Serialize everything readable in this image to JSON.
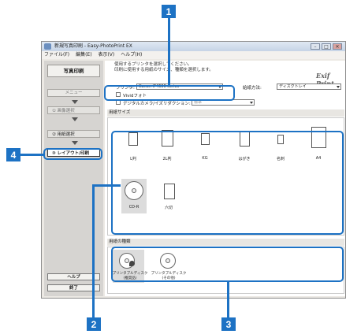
{
  "window": {
    "title": "新規写真印刷 - Easy-PhotoPrint EX",
    "menu": [
      "ファイル(F)",
      "編集(E)",
      "表示(V)",
      "ヘルプ(H)"
    ],
    "buttons": {
      "minimize": "–",
      "maximize": "□",
      "close": "✕"
    }
  },
  "sidebar": {
    "title": "写真印刷",
    "menu_button": "メニュー",
    "steps": [
      "① 画像選択",
      "② 用紙選択",
      "③ レイアウト/印刷"
    ],
    "help_button": "ヘルプ",
    "exit_button": "終了"
  },
  "header": {
    "instruction_line1": "使用するプリンタを選択してください。",
    "instruction_line2": "印刷に使用する用紙のサイズ、種類を選択します。",
    "brand": "Exif Print"
  },
  "settings": {
    "printer_label": "プリンタ:",
    "printer_value": "Canon iP4600 series",
    "feed_label": "給紙方法:",
    "feed_value": "ディスクトレイ",
    "vivid_label": "Vividフォト",
    "camera_label": "デジタルカメラ/イズリダクション:",
    "camera_value": "標準"
  },
  "paper_size": {
    "heading": "用紙サイズ",
    "options": [
      "L判",
      "2L判",
      "KG",
      "はがき",
      "名刺",
      "A4",
      "CD-R",
      "六切"
    ]
  },
  "media_type": {
    "heading": "用紙の種類",
    "options": [
      "プリンタブルディスク(推奨品)",
      "プリンタブルディスク(その他)"
    ]
  },
  "callouts": [
    "1",
    "2",
    "3",
    "4"
  ],
  "colors": {
    "accent": "#1d72c4"
  }
}
